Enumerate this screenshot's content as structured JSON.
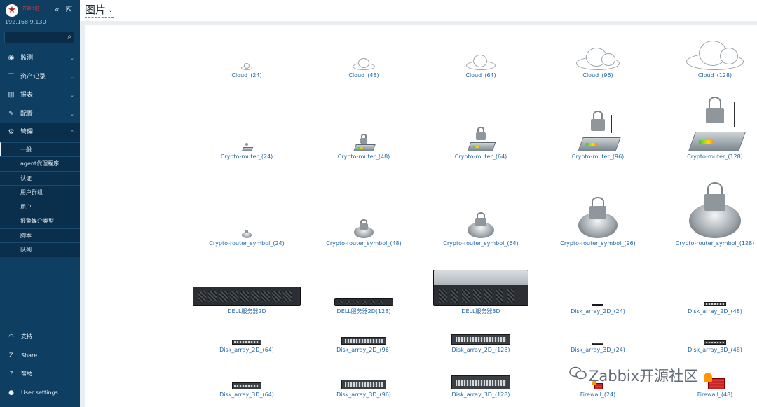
{
  "sidebar": {
    "brand_text": "开源社区",
    "ip": "192.168.9.130",
    "menu": [
      {
        "label": "监测",
        "icon": "eye-icon",
        "glyph": "◉"
      },
      {
        "label": "资产记录",
        "icon": "list-icon",
        "glyph": "☰"
      },
      {
        "label": "报表",
        "icon": "bar-chart-icon",
        "glyph": "▥"
      },
      {
        "label": "配置",
        "icon": "wrench-icon",
        "glyph": "🔧"
      },
      {
        "label": "管理",
        "icon": "gear-icon",
        "glyph": "⚙"
      }
    ],
    "submenu": [
      "一般",
      "agent代理程序",
      "认证",
      "用户群组",
      "用户",
      "报警媒介类型",
      "脚本",
      "队列"
    ],
    "footer": [
      {
        "label": "支持",
        "icon": "headset-icon",
        "glyph": "◠"
      },
      {
        "label": "Share",
        "icon": "share-icon",
        "glyph": "Z"
      },
      {
        "label": "帮助",
        "icon": "help-icon",
        "glyph": "?"
      },
      {
        "label": "User settings",
        "icon": "user-icon",
        "glyph": "●"
      }
    ]
  },
  "header": {
    "title": "图片"
  },
  "images": {
    "cloud": [
      "Cloud_(24)",
      "Cloud_(48)",
      "Cloud_(64)",
      "Cloud_(96)",
      "Cloud_(128)"
    ],
    "crypto_router": [
      "Crypto-router_(24)",
      "Crypto-router_(48)",
      "Crypto-router_(64)",
      "Crypto-router_(96)",
      "Crypto-router_(128)"
    ],
    "crypto_router_symbol": [
      "Crypto-router_symbol_(24)",
      "Crypto-router_symbol_(48)",
      "Crypto-router_symbol_(64)",
      "Crypto-router_symbol_(96)",
      "Crypto-router_symbol_(128)"
    ],
    "row4": [
      "DELL服务器2D",
      "DELL服务器2D(128)",
      "DELL服务器3D",
      "Disk_array_2D_(24)",
      "Disk_array_2D_(48)"
    ],
    "row5": [
      "Disk_array_2D_(64)",
      "Disk_array_2D_(96)",
      "Disk_array_2D_(128)",
      "Disk_array_3D_(24)",
      "Disk_array_3D_(48)"
    ],
    "row6": [
      "Disk_array_3D_(64)",
      "Disk_array_3D_(96)",
      "Disk_array_3D_(128)",
      "Firewall_(24)",
      "Firewall_(48)"
    ]
  },
  "watermark": "Zabbix开源社区"
}
